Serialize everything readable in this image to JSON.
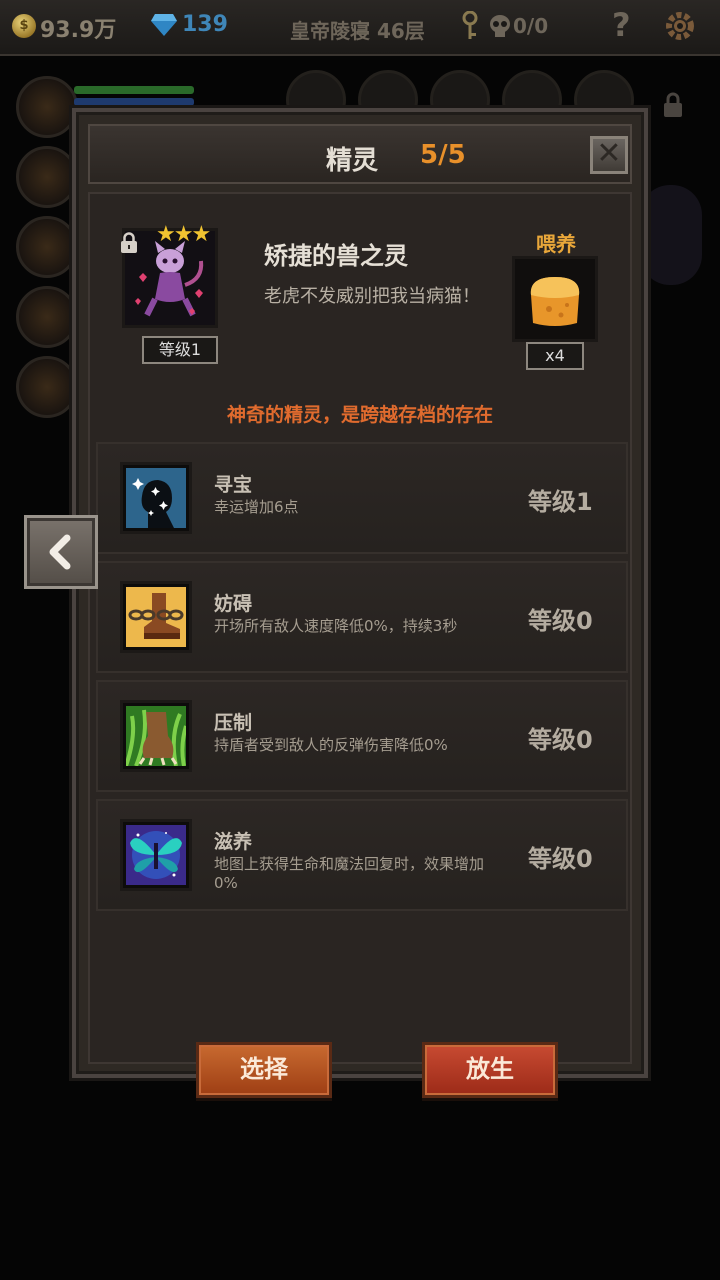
{
  "topbar": {
    "gold": "93.9万",
    "gems": "139",
    "floor": "皇帝陵寝 46层",
    "kills": "0/0",
    "help_label": "?"
  },
  "modal": {
    "title": "精灵",
    "count": "5/5",
    "close_label": "✕"
  },
  "pet": {
    "stars": "★★★",
    "level": "等级1",
    "name": "矫捷的兽之灵",
    "description": "老虎不发威别把我当病猫！",
    "feed_label": "喂养",
    "feed_count": "x4",
    "tagline": "神奇的精灵，是跨越存档的存在"
  },
  "skills": [
    {
      "name": "寻宝",
      "description": "幸运增加6点",
      "level": "等级1",
      "icon": "silhouette-stars-icon"
    },
    {
      "name": "妨碍",
      "description": "开场所有敌人速度降低0%，持续3秒",
      "level": "等级0",
      "icon": "chained-boot-icon"
    },
    {
      "name": "压制",
      "description": "持盾者受到敌人的反弹伤害降低0%",
      "level": "等级0",
      "icon": "beast-claw-icon"
    },
    {
      "name": "滋养",
      "description": "地图上获得生命和魔法回复时，效果增加0%",
      "level": "等级0",
      "icon": "fairy-wings-icon"
    }
  ],
  "buttons": {
    "select": "选择",
    "release": "放生"
  },
  "colors": {
    "count": "#e8902a",
    "tagline": "#e06b2e",
    "feed_label": "#e9a73a",
    "stars": "#f0c330"
  }
}
